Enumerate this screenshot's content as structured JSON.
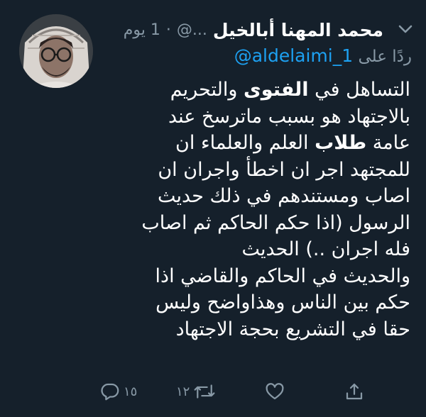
{
  "tweet": {
    "display_name": "محمد المهنا أبالخيل",
    "handle": "@...",
    "separator": "·",
    "time": "1 يوم",
    "reply_prefix": "ردًا على",
    "reply_to": "@aldelaimi_1",
    "body_lines": [
      [
        {
          "t": "التساهل في "
        },
        {
          "t": "الفتوى",
          "b": true
        },
        {
          "t": " والتحريم"
        }
      ],
      [
        {
          "t": "بالاجتهاد هو بسبب ماترسخ عند"
        }
      ],
      [
        {
          "t": "عامة "
        },
        {
          "t": "طلاب",
          "b": true
        },
        {
          "t": " العلم والعلماء ان"
        }
      ],
      [
        {
          "t": "للمجتهد اجر ان اخطأ واجران ان"
        }
      ],
      [
        {
          "t": "اصاب ومستندهم في ذلك حديث"
        }
      ],
      [
        {
          "t": "الرسول (اذا حكم الحاكم ثم اصاب"
        }
      ],
      [
        {
          "t": "فله اجران ..) الحديث"
        }
      ],
      [
        {
          "t": "والحديث في الحاكم والقاضي اذا"
        }
      ],
      [
        {
          "t": "حكم بين الناس وهذاواضح وليس"
        }
      ],
      [
        {
          "t": "حقا في التشريع بحجة الاجتهاد"
        }
      ]
    ],
    "actions": {
      "reply_count": "١٥",
      "retweet_count": "١٢"
    }
  },
  "colors": {
    "background": "#15202b",
    "text_primary": "#ffffff",
    "text_secondary": "#8899a6",
    "link": "#1da1f2"
  },
  "icons": [
    "avatar",
    "chevron-down-icon",
    "reply-icon",
    "retweet-icon",
    "like-icon",
    "share-icon"
  ]
}
